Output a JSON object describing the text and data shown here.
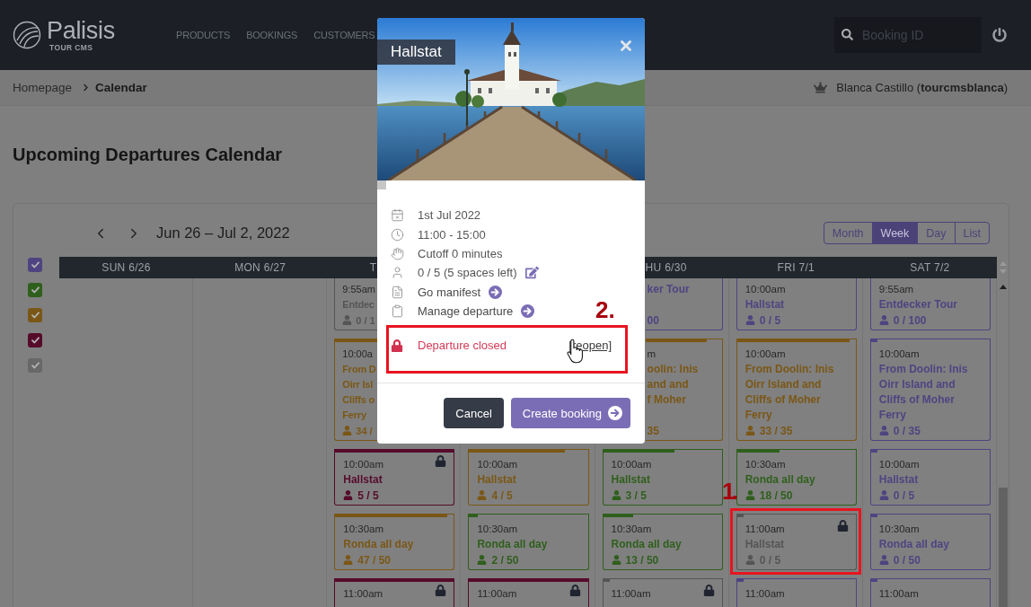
{
  "header": {
    "logo": {
      "name": "Palisis",
      "tagline": "TOUR CMS"
    },
    "nav": [
      "PRODUCTS",
      "BOOKINGS",
      "CUSTOMERS"
    ],
    "search": {
      "placeholder": "Booking ID"
    }
  },
  "breadcrumb": [
    {
      "label": "Homepage",
      "current": false
    },
    {
      "label": "Calendar",
      "current": true
    }
  ],
  "user": "Blanca Castillo (**tourcmsblanca**)",
  "page_title": "Upcoming Departures Calendar",
  "calendar": {
    "range": "Jun 26 – Jul 2, 2022",
    "views": [
      {
        "label": "Month",
        "selected": false
      },
      {
        "label": "Week",
        "selected": true
      },
      {
        "label": "Day",
        "selected": false
      },
      {
        "label": "List",
        "selected": false
      }
    ],
    "filters": [
      {
        "checked": true,
        "color": "#4f4481"
      },
      {
        "checked": true,
        "color": "#2f5f1c"
      },
      {
        "checked": true,
        "color": "#7a5716"
      },
      {
        "checked": true,
        "color": "#560b2b"
      },
      {
        "checked": true,
        "color": "#686868"
      }
    ],
    "days": [
      {
        "label": "SUN 6/26",
        "kind": "full"
      },
      {
        "label": "MON 6/27",
        "kind": "full"
      },
      {
        "label": "T",
        "kind": "left-part",
        "events": [
          {
            "kind": "left-part",
            "time": "9:55am",
            "title": "Entdec",
            "count": "0 / 1",
            "color": "#555555",
            "locked": false
          },
          {
            "kind": "left-part",
            "time": "10:00a",
            "title": "From D\nOirr Isl\nCliffs o\nFerry",
            "count": "34 /",
            "color": "#7a5716",
            "level": 1,
            "locked": false
          },
          {
            "kind": "full",
            "time": "10:00am",
            "title": "Hallstat",
            "count": "5 / 5",
            "color": "#560b2b",
            "level": 1,
            "locked": true
          },
          {
            "kind": "full",
            "time": "10:30am",
            "title": "Ronda all day",
            "count": "47 / 50",
            "color": "#7a5716",
            "level": 0.94,
            "locked": false
          },
          {
            "kind": "full",
            "time": "11:00am",
            "color": "#560b2b",
            "level": 1,
            "locked": true
          }
        ]
      },
      {
        "events": [
          {
            "kind": "full",
            "time": "10:00am",
            "title": "Hallstat",
            "count": "4 / 5",
            "color": "#7a5716",
            "level": 0.8,
            "locked": false
          },
          {
            "kind": "full",
            "time": "10:30am",
            "title": "Ronda all day",
            "count": "2 / 50",
            "color": "#2f5f1c",
            "level": 0.08,
            "locked": false
          },
          {
            "kind": "full",
            "time": "11:00am",
            "color": "#560b2b",
            "level": 1,
            "locked": true
          }
        ]
      },
      {
        "label": "HU 6/30",
        "kind": "right-part",
        "events": [
          {
            "kind": "right-part",
            "title": "ker Tour",
            "count": "00",
            "color": "#4f4481",
            "locked": false
          },
          {
            "kind": "right-part",
            "time": "m",
            "title": "oolin: Inis\nand and\nf Moher",
            "count": "35",
            "color": "#7a5716",
            "level": 0.79,
            "locked": false
          },
          {
            "kind": "full",
            "time": "10:00am",
            "title": "Hallstat",
            "count": "3 / 5",
            "color": "#2f5f1c",
            "level": 0.6,
            "locked": false
          },
          {
            "kind": "full",
            "time": "10:30am",
            "title": "Ronda all day",
            "count": "13 / 50",
            "color": "#2f5f1c",
            "level": 0.26,
            "locked": false
          },
          {
            "kind": "full",
            "time": "11:00am",
            "color": "#555555",
            "level": 0.06,
            "locked": true
          }
        ]
      },
      {
        "label": "FRI 7/1",
        "kind": "full",
        "events": [
          {
            "kind": "full",
            "time": "10:00am",
            "title": "Hallstat",
            "count": "0 / 5",
            "color": "#4f4481",
            "locked": false
          },
          {
            "kind": "full",
            "time": "10:00am",
            "title": "From Doolin: Inis Oirr Island and Cliffs of Moher Ferry",
            "count": "33 / 35",
            "color": "#7a5716",
            "level": 0.94,
            "locked": false
          },
          {
            "kind": "full",
            "time": "10:30am",
            "title": "Ronda all day",
            "count": "18 / 50",
            "color": "#2f5f1c",
            "level": 0.36,
            "locked": false
          },
          {
            "kind": "full",
            "time": "11:00am",
            "title": "Hallstat",
            "count": "0 / 5",
            "color": "#555555",
            "level": 0.06,
            "locked": true
          },
          {
            "kind": "full",
            "time": "11:00am",
            "color": "#4f4481",
            "level": 0.06,
            "locked": false
          }
        ]
      },
      {
        "label": "SAT 7/2",
        "kind": "full",
        "events": [
          {
            "kind": "full",
            "time": "9:55am",
            "title": "Entdecker Tour",
            "count": "0 / 100",
            "color": "#4f4481",
            "locked": false
          },
          {
            "kind": "full",
            "time": "10:00am",
            "title": "From Doolin: Inis Oirr Island and Cliffs of Moher Ferry",
            "count": "0 / 35",
            "color": "#4f4481",
            "level": 0.06,
            "locked": false
          },
          {
            "kind": "full",
            "time": "10:00am",
            "title": "Hallstat",
            "count": "0 / 5",
            "color": "#4f4481",
            "level": 0.06,
            "locked": false
          },
          {
            "kind": "full",
            "time": "10:30am",
            "title": "Ronda all day",
            "count": "0 / 50",
            "color": "#4f4481",
            "level": 0.06,
            "locked": false
          },
          {
            "kind": "full",
            "time": "11:00am",
            "color": "#4f4481",
            "level": 0.06,
            "locked": false
          }
        ]
      }
    ]
  },
  "dialog": {
    "title": "Hallstat",
    "details": [
      {
        "kind": "date",
        "text": "1st Jul 2022"
      },
      {
        "kind": "time",
        "text": "11:00 - 15:00"
      },
      {
        "kind": "cutoff",
        "text": "Cutoff 0 minutes"
      },
      {
        "kind": "spaces",
        "text": "0 / 5 (5 spaces left)"
      },
      {
        "kind": "manifest",
        "text": "Go manifest"
      },
      {
        "kind": "manage",
        "text": "Manage departure"
      }
    ],
    "status": {
      "text": "Departure closed",
      "link": "[reopen]"
    },
    "buttons": [
      {
        "label": "Cancel",
        "kind": "secondary"
      },
      {
        "label": "Create booking",
        "kind": "primary"
      }
    ]
  },
  "annotations": [
    {
      "label": "1."
    },
    {
      "label": "2."
    }
  ]
}
